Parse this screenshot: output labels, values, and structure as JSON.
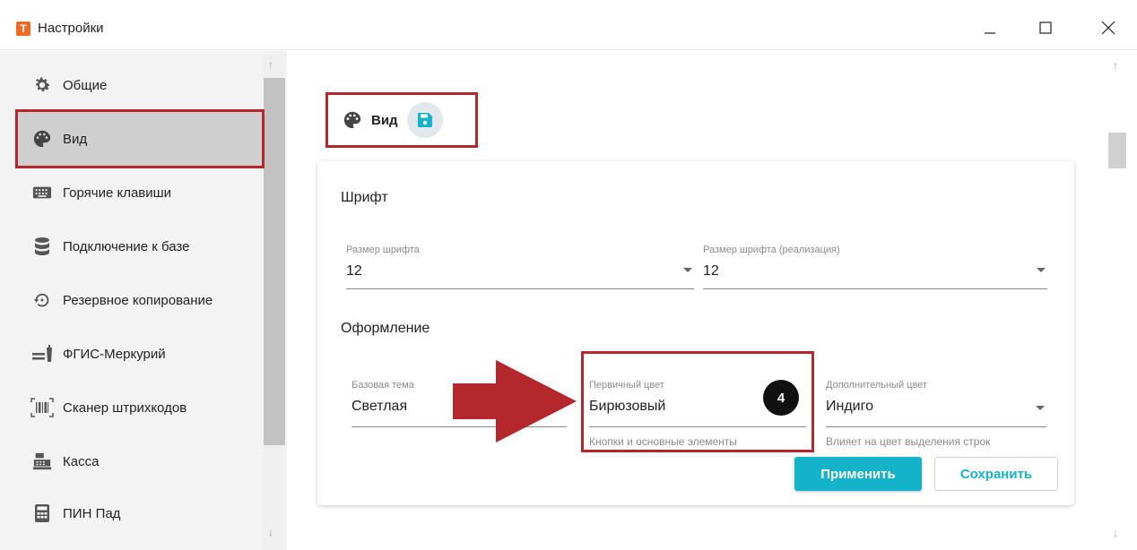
{
  "window": {
    "title": "Настройки",
    "logo_letter": "T",
    "logo_color": "#f06a24"
  },
  "sidebar": {
    "items": [
      {
        "label": "Общие",
        "icon": "gear-icon"
      },
      {
        "label": "Вид",
        "icon": "palette-icon",
        "active": true
      },
      {
        "label": "Горячие клавиши",
        "icon": "keyboard-icon"
      },
      {
        "label": "Подключение к базе",
        "icon": "database-icon"
      },
      {
        "label": "Резервное копирование",
        "icon": "backup-restore-icon"
      },
      {
        "label": "ФГИС-Меркурий",
        "icon": "mercury-icon"
      },
      {
        "label": "Сканер штрихкодов",
        "icon": "barcode-scanner-icon"
      },
      {
        "label": "Касса",
        "icon": "cash-register-icon"
      },
      {
        "label": "ПИН Пад",
        "icon": "calculator-icon"
      }
    ]
  },
  "page": {
    "title": "Вид",
    "title_icon": "palette-icon",
    "save_icon": "floppy-disk-icon"
  },
  "font_section": {
    "title": "Шрифт",
    "font_size": {
      "label": "Размер шрифта",
      "value": "12"
    },
    "font_size_sale": {
      "label": "Размер шрифта (реализация)",
      "value": "12"
    }
  },
  "design_section": {
    "title": "Оформление",
    "base_theme": {
      "label": "Базовая тема",
      "value": "Светлая"
    },
    "primary_color": {
      "label": "Первичный цвет",
      "value": "Бирюзовый",
      "hint": "Кнопки и основные элементы"
    },
    "secondary_color": {
      "label": "Дополнительный цвет",
      "value": "Индиго",
      "hint": "Влияет на цвет выделения строк"
    }
  },
  "annotation": {
    "step": "4",
    "color": "#b3272d"
  },
  "actions": {
    "apply_label": "Применить",
    "save_label": "Сохранить",
    "accent": "#15b3c9"
  }
}
